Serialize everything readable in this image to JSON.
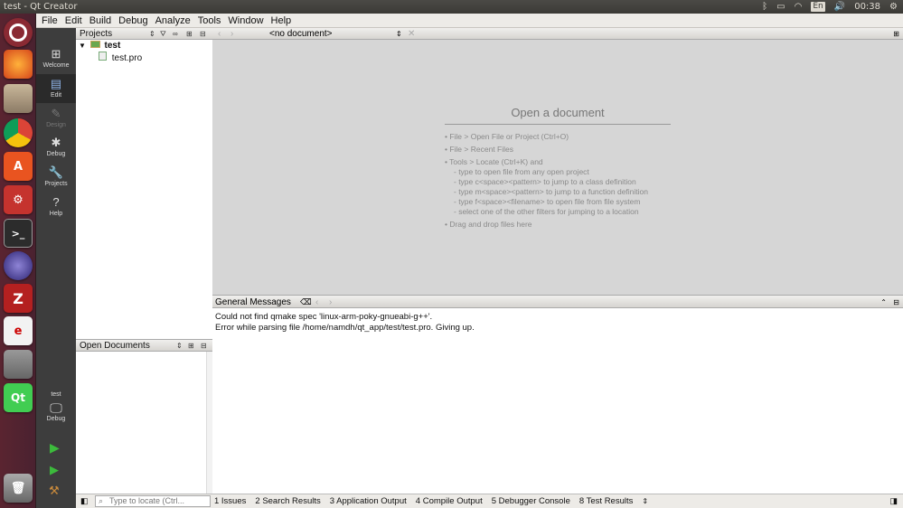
{
  "window": {
    "title": "test - Qt Creator"
  },
  "tray": {
    "lang": "En",
    "clock": "00:38"
  },
  "menubar": [
    "File",
    "Edit",
    "Build",
    "Debug",
    "Analyze",
    "Tools",
    "Window",
    "Help"
  ],
  "modes": [
    {
      "label": "Welcome",
      "icon": "⊞"
    },
    {
      "label": "Edit",
      "icon": "▤"
    },
    {
      "label": "Design",
      "icon": "✎"
    },
    {
      "label": "Debug",
      "icon": "✱"
    },
    {
      "label": "Projects",
      "icon": "🔧"
    },
    {
      "label": "Help",
      "icon": "?"
    }
  ],
  "kit": {
    "project": "test",
    "config": "Debug"
  },
  "projects_panel": {
    "title": "Projects",
    "root": "test",
    "files": [
      "test.pro"
    ]
  },
  "open_docs": {
    "title": "Open Documents"
  },
  "editor": {
    "doc_selector": "<no document>"
  },
  "welcome": {
    "heading": "Open a document",
    "lines": [
      "• File > Open File or Project (Ctrl+O)",
      "• File > Recent Files",
      "• Tools > Locate (Ctrl+K) and",
      "- type to open file from any open project",
      "- type c<space><pattern> to jump to a class definition",
      "- type m<space><pattern> to jump to a function definition",
      "- type f<space><filename> to open file from file system",
      "- select one of the other filters for jumping to a location",
      "• Drag and drop files here"
    ]
  },
  "output": {
    "title": "General Messages",
    "lines": [
      "Could not find qmake spec 'linux-arm-poky-gnueabi-g++'.",
      "Error while parsing file /home/namdh/qt_app/test/test.pro. Giving up."
    ]
  },
  "statusbar": {
    "locate_placeholder": "Type to locate (Ctrl...",
    "tabs": [
      "1  Issues",
      "2  Search Results",
      "3  Application Output",
      "4  Compile Output",
      "5  Debugger Console",
      "8  Test Results"
    ]
  }
}
